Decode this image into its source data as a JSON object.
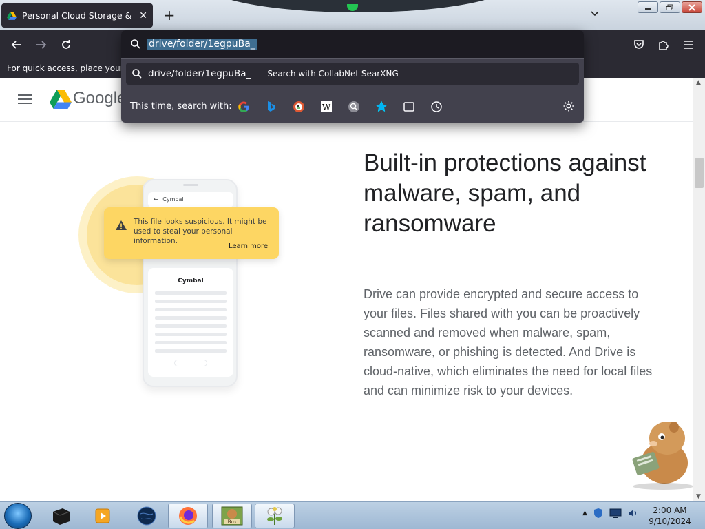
{
  "browser": {
    "tab": {
      "title": "Personal Cloud Storage & File Sharing Platform - Google",
      "close_symbol": "✕"
    },
    "new_tab_symbol": "+",
    "bookmarks_bar_text": "For quick access, place your bookmarks here on the bookmarks toolbar.",
    "urlbar": {
      "value": "drive/folder/1egpuBa_",
      "suggestion": {
        "text": "drive/folder/1egpuBa_",
        "dash": "—",
        "hint": "Search with CollabNet SearXNG"
      },
      "one_off_label": "This time, search with:",
      "engines": [
        "google-icon",
        "bing-icon",
        "duckduckgo-icon",
        "wikipedia-icon",
        "searxng-icon",
        "bookmarks-icon",
        "tabs-icon",
        "history-icon"
      ]
    }
  },
  "page": {
    "logo_text": "Google",
    "heading": "Built-in protections against malware, spam, and ransomware",
    "body": "Drive can provide encrypted and secure access to your files. Files shared with you can be proactively scanned and removed when malware, spam, ransomware, or phishing is detected. And Drive is cloud-native, which eliminates the need for local files and can minimize risk to your devices.",
    "illustration": {
      "app_name": "Cymbal",
      "warning": "This file looks suspicious. It might be used to steal your personal information.",
      "learn_more": "Learn more",
      "doc_title": "Cymbal"
    }
  },
  "taskbar": {
    "clock_time": "2:00 AM",
    "clock_date": "9/10/2024",
    "box_label": "Box"
  },
  "colors": {
    "browser_dark": "#2b2a33",
    "urlbar_select": "#3f6e91",
    "warning_yellow": "#fdd663",
    "heading": "#202124",
    "body": "#5f6368"
  }
}
